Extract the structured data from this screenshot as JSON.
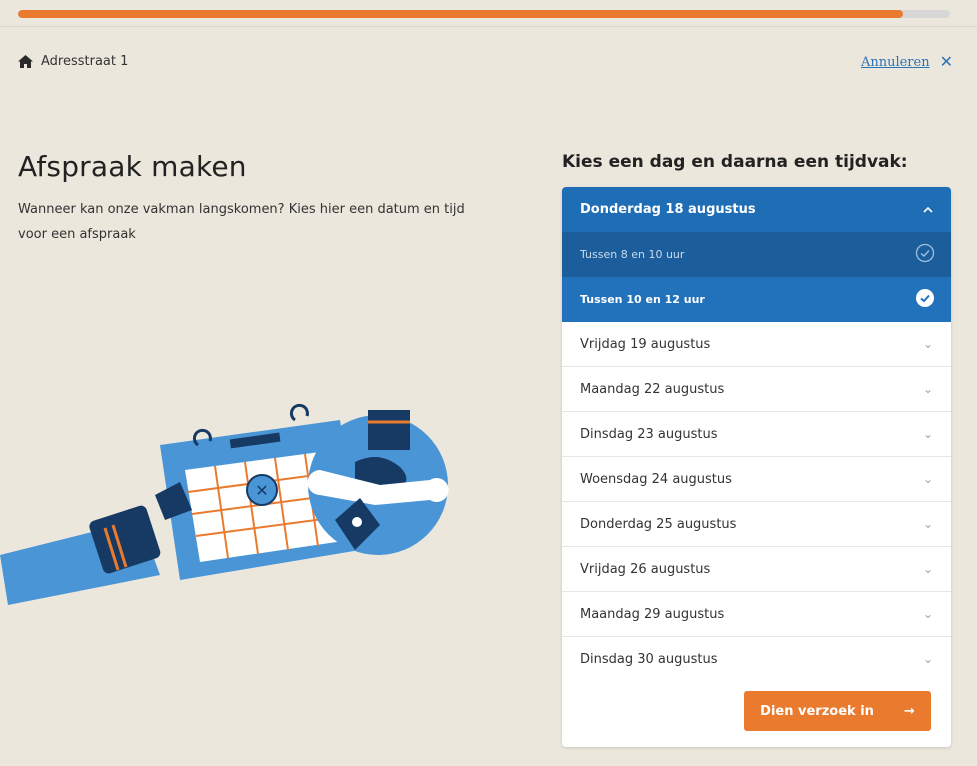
{
  "progress": {
    "percent": 95
  },
  "breadcrumb": {
    "icon": "home-icon",
    "label": "Adresstraat 1"
  },
  "cancel": {
    "label": "Annuleren",
    "icon": "close-icon"
  },
  "page": {
    "title": "Afspraak maken",
    "intro": "Wanneer kan onze vakman langskomen? Kies hier een datum en tijd voor een afspraak"
  },
  "picker": {
    "heading": "Kies een dag en daarna een tijdvak:",
    "expanded_day": "Donderdag 18 augustus",
    "slots": [
      {
        "label": "Tussen 8 en 10 uur",
        "selected": false
      },
      {
        "label": "Tussen 10 en 12 uur",
        "selected": true
      }
    ],
    "days": [
      "Vrijdag 19 augustus",
      "Maandag 22 augustus",
      "Dinsdag 23 augustus",
      "Woensdag 24 augustus",
      "Donderdag 25 augustus",
      "Vrijdag 26 augustus",
      "Maandag 29 augustus",
      "Dinsdag 30 augustus"
    ],
    "submit_label": "Dien verzoek in"
  },
  "colors": {
    "accent": "#ea7a2e",
    "primary": "#1f6db5",
    "background": "#ece7dc"
  }
}
